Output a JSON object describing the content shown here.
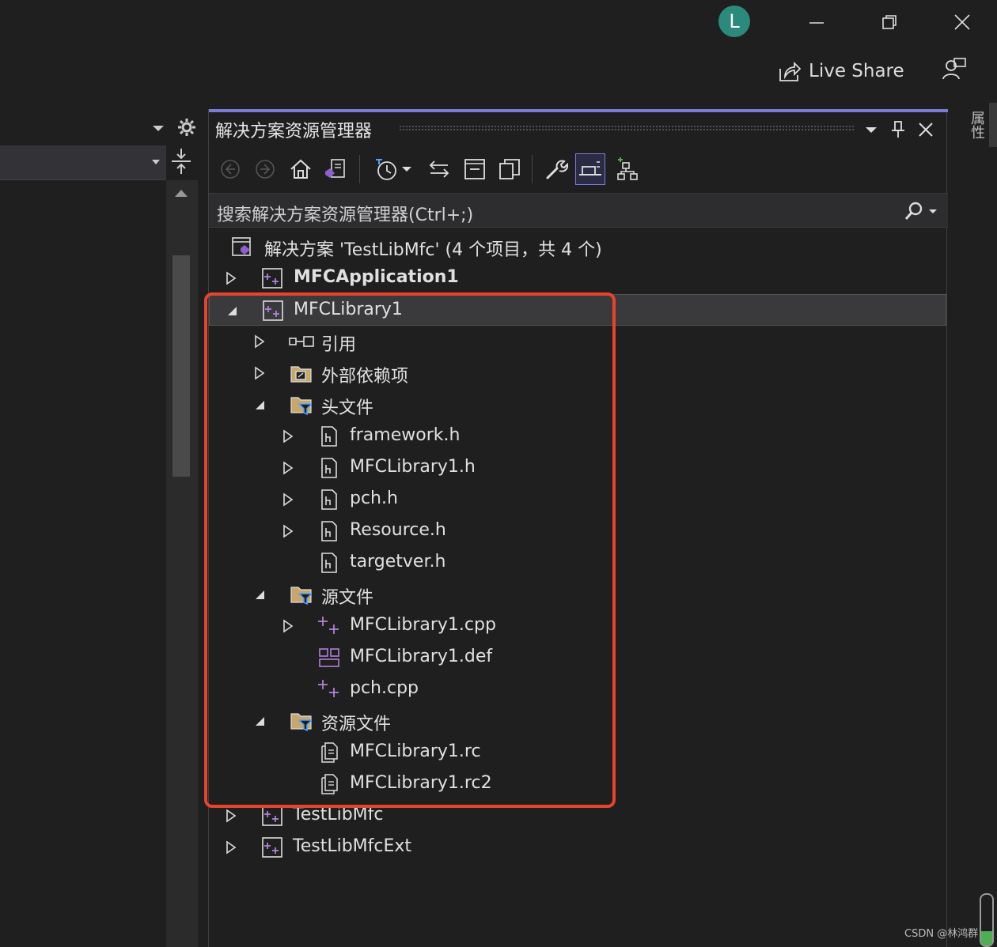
{
  "titlebar": {
    "avatar_letter": "L",
    "live_share_label": "Live Share"
  },
  "solution_explorer": {
    "title": "解决方案资源管理器",
    "search_placeholder": "搜索解决方案资源管理器(Ctrl+;)",
    "tree": {
      "solution": "解决方案 'TestLibMfc' (4 个项目，共 4 个)",
      "project_mfcapp": "MFCApplication1",
      "project_mfclib": "MFCLibrary1",
      "references": "引用",
      "external_deps": "外部依赖项",
      "header_files": "头文件",
      "framework_h": "framework.h",
      "mfclibrary1_h": "MFCLibrary1.h",
      "pch_h": "pch.h",
      "resource_h": "Resource.h",
      "targetver_h": "targetver.h",
      "source_files": "源文件",
      "mfclibrary1_cpp": "MFCLibrary1.cpp",
      "mfclibrary1_def": "MFCLibrary1.def",
      "pch_cpp": "pch.cpp",
      "resource_files": "资源文件",
      "mfclibrary1_rc": "MFCLibrary1.rc",
      "mfclibrary1_rc2": "MFCLibrary1.rc2",
      "project_testlibmfc": "TestLibMfc",
      "project_testlibmfcext": "TestLibMfcExt"
    }
  },
  "right_strip": {
    "tab_label": "属性"
  },
  "watermark": "CSDN @林鸿群",
  "colors": {
    "background": "#1f1f1f",
    "accent": "#7a7dd8",
    "highlight_box": "#e8432e",
    "avatar": "#2b8a7c",
    "icon_purple": "#b180d7"
  }
}
